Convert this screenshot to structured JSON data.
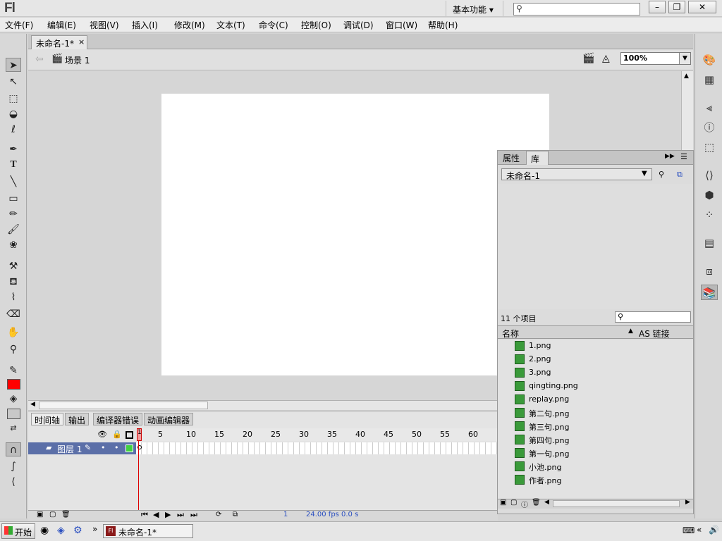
{
  "app": {
    "logo": "Fl",
    "workspace": "基本功能 ▾"
  },
  "menu": [
    "文件(F)",
    "编辑(E)",
    "视图(V)",
    "插入(I)",
    "修改(M)",
    "文本(T)",
    "命令(C)",
    "控制(O)",
    "调试(D)",
    "窗口(W)",
    "帮助(H)"
  ],
  "document": {
    "tab": "未命名-1*",
    "close": "×",
    "scene": "场景 1",
    "zoom": "100%"
  },
  "timeline": {
    "tabs": [
      "时间轴",
      "输出",
      "编译器错误",
      "动画编辑器"
    ],
    "layer": "图层 1",
    "frame_ticks": [
      "1",
      "5",
      "10",
      "15",
      "20",
      "25",
      "30",
      "35",
      "40",
      "45",
      "50",
      "55",
      "60"
    ],
    "status": {
      "frame": "1",
      "fps": "24.00 fps",
      "time": "0.0 s"
    }
  },
  "library": {
    "tabs": [
      "属性",
      "库"
    ],
    "document": "未命名-1",
    "count": "11 个项目",
    "columns": {
      "name": "名称",
      "link": "AS 链接"
    },
    "items": [
      "1.png",
      "2.png",
      "3.png",
      "qingting.png",
      "replay.png",
      "第二句.png",
      "第三句.png",
      "第四句.png",
      "第一句.png",
      "小池.png",
      "作者.png"
    ]
  },
  "taskbar": {
    "start": "开始",
    "window": "未命名-1*"
  }
}
